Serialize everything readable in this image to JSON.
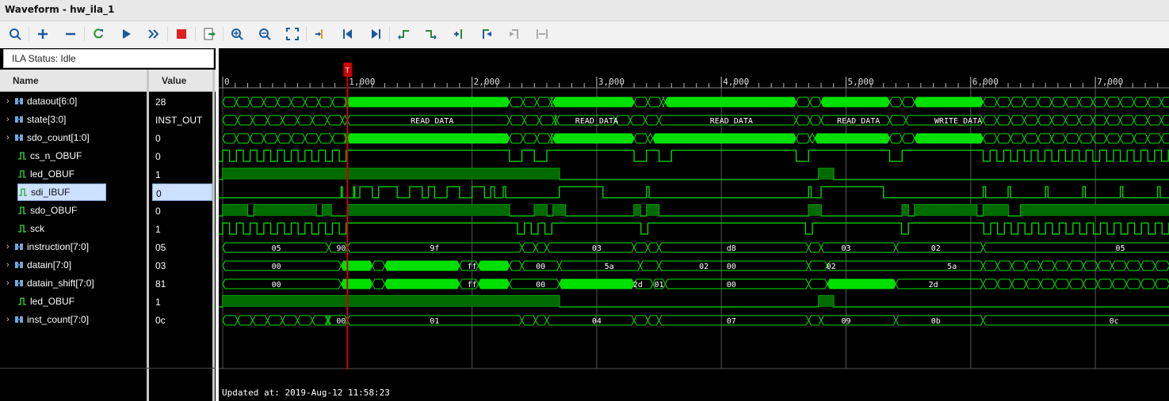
{
  "window": {
    "title": "Waveform - hw_ila_1"
  },
  "toolbar": {
    "buttons": [
      {
        "name": "search-button",
        "icon": "search-icon"
      },
      {
        "name": "add-button",
        "icon": "plus-icon"
      },
      {
        "name": "remove-button",
        "icon": "minus-icon"
      },
      {
        "name": "run-trigger-immediate-button",
        "icon": "refresh-icon"
      },
      {
        "name": "run-button",
        "icon": "play-icon"
      },
      {
        "name": "run-continuous-button",
        "icon": "fast-forward-icon"
      },
      {
        "name": "stop-button",
        "icon": "stop-icon"
      },
      {
        "name": "export-button",
        "icon": "export-icon"
      },
      {
        "name": "zoom-in-button",
        "icon": "zoom-in-icon"
      },
      {
        "name": "zoom-out-button",
        "icon": "zoom-out-icon"
      },
      {
        "name": "zoom-fit-button",
        "icon": "zoom-fit-icon"
      },
      {
        "name": "go-to-cursor-button",
        "icon": "cursor-icon"
      },
      {
        "name": "go-to-start-button",
        "icon": "go-start-icon"
      },
      {
        "name": "go-to-end-button",
        "icon": "go-end-icon"
      },
      {
        "name": "previous-transition-button",
        "icon": "prev-transition-icon"
      },
      {
        "name": "next-transition-button",
        "icon": "next-transition-icon"
      },
      {
        "name": "add-marker-button",
        "icon": "add-marker-icon"
      },
      {
        "name": "previous-marker-button",
        "icon": "prev-marker-icon"
      },
      {
        "name": "next-marker-button",
        "icon": "next-marker-icon"
      },
      {
        "name": "swap-cursors-button",
        "icon": "swap-icon"
      }
    ]
  },
  "status": {
    "text": "ILA Status:  Idle"
  },
  "columns": {
    "name": "Name",
    "value": "Value"
  },
  "signals": [
    {
      "name": "dataout[6:0]",
      "value": "28",
      "kind": "bus",
      "expandable": true
    },
    {
      "name": "state[3:0]",
      "value": "INST_OUT",
      "kind": "bus",
      "expandable": true
    },
    {
      "name": "sdo_count[1:0]",
      "value": "0",
      "kind": "bus",
      "expandable": true
    },
    {
      "name": "cs_n_OBUF",
      "value": "0",
      "kind": "bit",
      "expandable": false
    },
    {
      "name": "led_OBUF",
      "value": "1",
      "kind": "bit",
      "expandable": false
    },
    {
      "name": "sdi_IBUF",
      "value": "0",
      "kind": "bit",
      "expandable": false,
      "selected": true
    },
    {
      "name": "sdo_OBUF",
      "value": "0",
      "kind": "bit",
      "expandable": false
    },
    {
      "name": "sck",
      "value": "1",
      "kind": "bit",
      "expandable": false
    },
    {
      "name": "instruction[7:0]",
      "value": "05",
      "kind": "bus",
      "expandable": true
    },
    {
      "name": "datain[7:0]",
      "value": "03",
      "kind": "bus",
      "expandable": true
    },
    {
      "name": "datain_shift[7:0]",
      "value": "81",
      "kind": "bus",
      "expandable": true
    },
    {
      "name": "led_OBUF",
      "value": "1",
      "kind": "bit",
      "expandable": false
    },
    {
      "name": "inst_count[7:0]",
      "value": "0c",
      "kind": "bus",
      "expandable": true
    }
  ],
  "timeline": {
    "ticks": [
      "0",
      "1,000",
      "2,000",
      "3,000",
      "4,000",
      "5,000",
      "6,000",
      "7,000"
    ],
    "tick_values": [
      0,
      1000,
      2000,
      3000,
      4000,
      5000,
      6000,
      7000
    ],
    "cursor": {
      "label": "T",
      "value": 1000
    }
  },
  "bus_labels": {
    "state": [
      {
        "t": 1680,
        "text": "READ_DATA"
      },
      {
        "t": 3000,
        "text": "READ_DATA"
      },
      {
        "t": 4080,
        "text": "READ_DATA"
      },
      {
        "t": 5100,
        "text": "READ_DATA"
      },
      {
        "t": 5900,
        "text": "WRITE_DATA"
      }
    ],
    "instruction": [
      {
        "t": 430,
        "text": "05"
      },
      {
        "t": 950,
        "text": "90"
      },
      {
        "t": 1700,
        "text": "9f"
      },
      {
        "t": 3000,
        "text": "03"
      },
      {
        "t": 4080,
        "text": "d8"
      },
      {
        "t": 5000,
        "text": "03"
      },
      {
        "t": 5720,
        "text": "02"
      },
      {
        "t": 7200,
        "text": "05"
      }
    ],
    "datain": [
      {
        "t": 430,
        "text": "00"
      },
      {
        "t": 2000,
        "text": "ff"
      },
      {
        "t": 2550,
        "text": "00"
      },
      {
        "t": 3100,
        "text": "5a"
      },
      {
        "t": 3860,
        "text": "02"
      },
      {
        "t": 4080,
        "text": "00"
      },
      {
        "t": 4880,
        "text": "02"
      },
      {
        "t": 5850,
        "text": "5a"
      }
    ],
    "datain_shift": [
      {
        "t": 430,
        "text": "00"
      },
      {
        "t": 2000,
        "text": "ff"
      },
      {
        "t": 2550,
        "text": "00"
      },
      {
        "t": 3330,
        "text": "2d"
      },
      {
        "t": 3500,
        "text": "01"
      },
      {
        "t": 4080,
        "text": "00"
      },
      {
        "t": 5700,
        "text": "2d"
      }
    ],
    "inst_count": [
      {
        "t": 950,
        "text": "00"
      },
      {
        "t": 1700,
        "text": "01"
      },
      {
        "t": 3000,
        "text": "04"
      },
      {
        "t": 4080,
        "text": "07"
      },
      {
        "t": 5000,
        "text": "09"
      },
      {
        "t": 5720,
        "text": "0b"
      },
      {
        "t": 7150,
        "text": "0c"
      }
    ]
  },
  "footer": {
    "updated": "Updated at: 2019-Aug-12 11:58:23"
  },
  "colors": {
    "wave": "#00e000",
    "wave_dim": "#006b00",
    "cursor": "#cc0000",
    "grid": "#555555",
    "bg": "#000000"
  }
}
